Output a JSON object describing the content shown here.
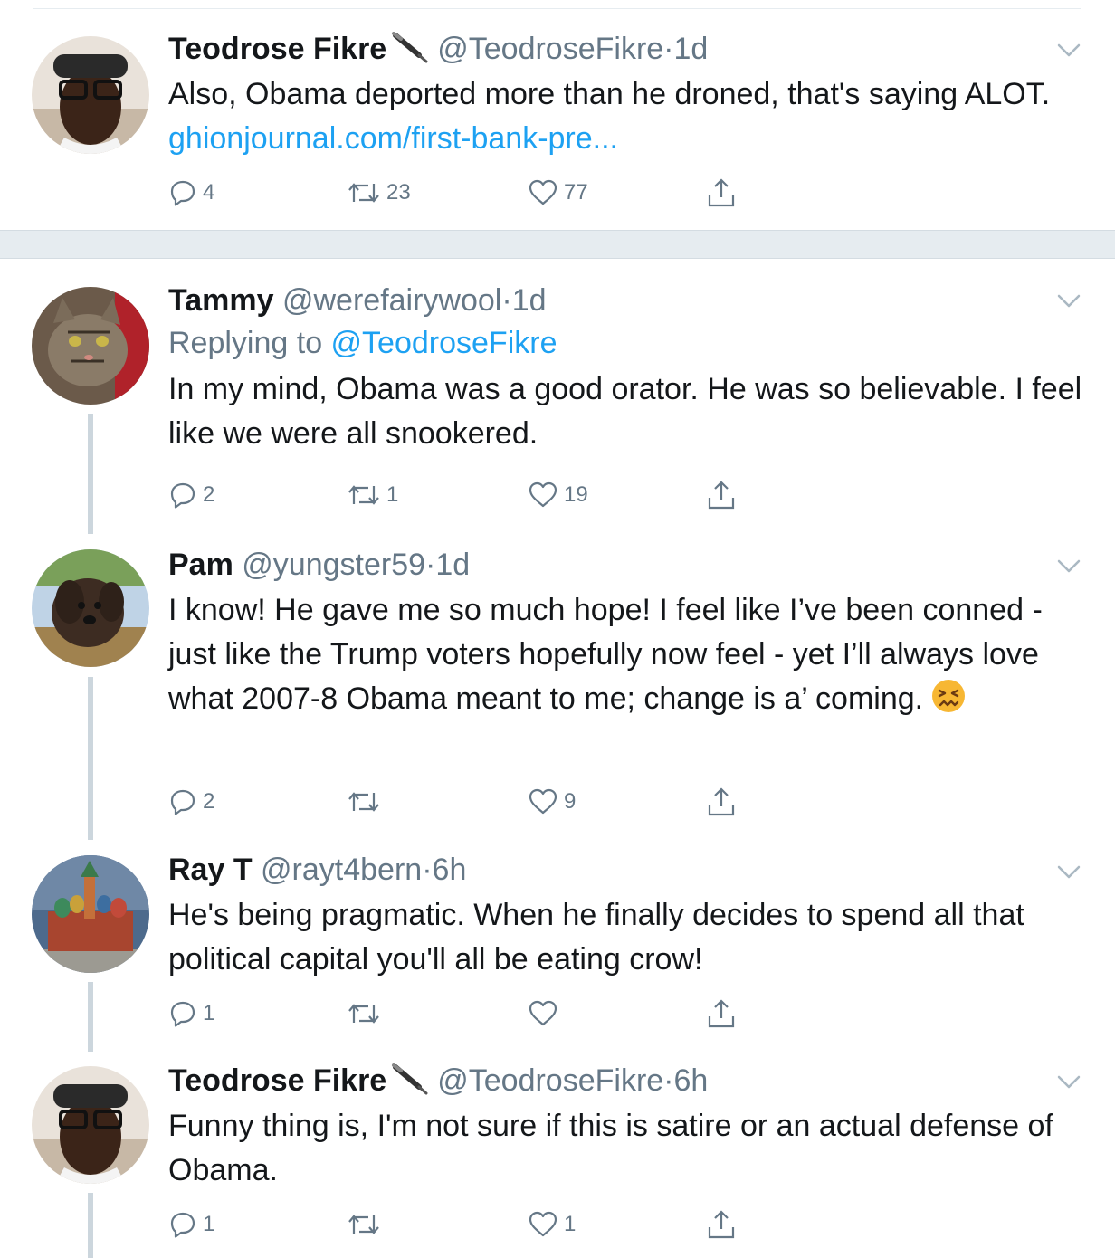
{
  "tweets": [
    {
      "name": "Teodrose Fikre",
      "verified_emoji": "pen-emoji",
      "handle": "@TeodroseFikre",
      "dot": "·",
      "time": "1d",
      "text_before_link": "Also, Obama deported more than he droned, that's saying ALOT. ",
      "link": "ghionjournal.com/first-bank-pre...",
      "counts": {
        "replies": "4",
        "retweets": "23",
        "likes": "77"
      }
    },
    {
      "name": "Tammy",
      "handle": "@werefairywool",
      "dot": "·",
      "time": "1d",
      "replying_prefix": "Replying to ",
      "replying_to": "@TeodroseFikre",
      "text": "In my mind, Obama was a good orator. He was so believable. I feel like we were all snookered.",
      "counts": {
        "replies": "2",
        "retweets": "1",
        "likes": "19"
      }
    },
    {
      "name": "Pam",
      "handle": "@yungster59",
      "dot": "·",
      "time": "1d",
      "text": "I know! He gave me so much hope! I feel like I’ve been conned - just like the Trump voters hopefully now feel - yet I’ll always love what 2007-8 Obama meant to me; change is a’ coming.",
      "emoji": "confounded-face-emoji",
      "counts": {
        "replies": "2",
        "retweets": "",
        "likes": "9"
      }
    },
    {
      "name": "Ray T",
      "handle": "@rayt4bern",
      "dot": "·",
      "time": "6h",
      "text": "He's being pragmatic. When he finally decides to spend all that political capital you'll all be eating crow!",
      "counts": {
        "replies": "1",
        "retweets": "",
        "likes": ""
      }
    },
    {
      "name": "Teodrose Fikre",
      "verified_emoji": "pen-emoji",
      "handle": "@TeodroseFikre",
      "dot": "·",
      "time": "6h",
      "text": "Funny thing is, I'm not sure if this is satire or an actual defense of Obama.",
      "counts": {
        "replies": "1",
        "retweets": "",
        "likes": "1"
      }
    }
  ],
  "colors": {
    "text": "#14171a",
    "secondary": "#657786",
    "link": "#1da1f2",
    "divider": "#e6ecf0",
    "thread_line": "#ccd6dd"
  },
  "icons": [
    "reply-icon",
    "retweet-icon",
    "like-icon",
    "share-icon",
    "chevron-down-icon"
  ]
}
